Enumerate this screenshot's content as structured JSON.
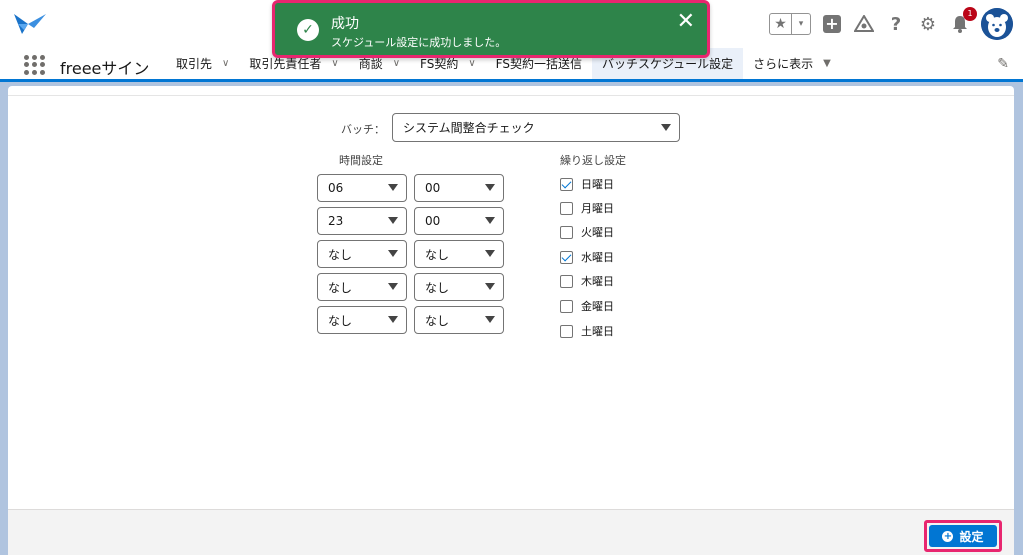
{
  "toast": {
    "title": "成功",
    "message": "スケジュール設定に成功しました。",
    "close_glyph": "✕"
  },
  "header": {
    "star_glyph": "★",
    "caret_glyph": "▾",
    "plus_glyph": "+",
    "help_glyph": "?",
    "gear_glyph": "⚙",
    "bell_glyph": "🔔",
    "notification_count": "1",
    "trailhead_glyph": "⛰"
  },
  "nav": {
    "app_name": "freeeサイン",
    "tabs": [
      {
        "label": "取引先",
        "chevron": "∨"
      },
      {
        "label": "取引先責任者",
        "chevron": "∨"
      },
      {
        "label": "商談",
        "chevron": "∨"
      },
      {
        "label": "FS契約",
        "chevron": "∨"
      },
      {
        "label": "FS契約一括送信"
      },
      {
        "label": "バッチスケジュール設定"
      },
      {
        "label": "さらに表示",
        "chevron": "▼"
      }
    ],
    "edit_glyph": "✎"
  },
  "form": {
    "batch_label": "バッチ：",
    "batch_value": "システム間整合チェック",
    "time_label": "時間設定",
    "repeat_label": "繰り返し設定",
    "times": [
      {
        "hour": "06",
        "minute": "00"
      },
      {
        "hour": "23",
        "minute": "00"
      },
      {
        "hour": "なし",
        "minute": "なし"
      },
      {
        "hour": "なし",
        "minute": "なし"
      },
      {
        "hour": "なし",
        "minute": "なし"
      }
    ],
    "days": [
      {
        "label": "日曜日",
        "checked": true
      },
      {
        "label": "月曜日",
        "checked": false
      },
      {
        "label": "火曜日",
        "checked": false
      },
      {
        "label": "水曜日",
        "checked": true
      },
      {
        "label": "木曜日",
        "checked": false
      },
      {
        "label": "金曜日",
        "checked": false
      },
      {
        "label": "土曜日",
        "checked": false
      }
    ]
  },
  "footer": {
    "set_label": "設定",
    "plus_glyph": "+"
  },
  "colors": {
    "brand": "#0176d3",
    "toast_bg": "#2e844a",
    "highlight": "#e8266f"
  }
}
